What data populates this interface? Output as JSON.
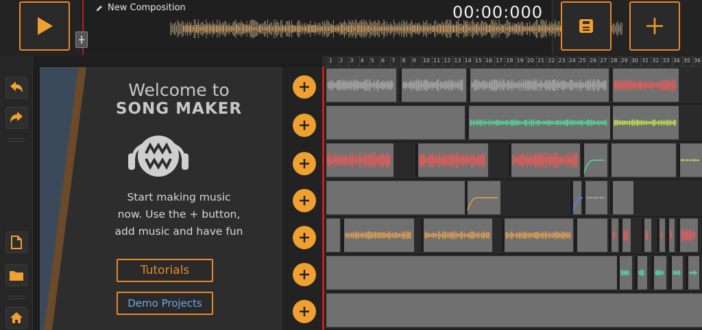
{
  "composition": {
    "title": "New Composition",
    "time": "00:00:000"
  },
  "welcome": {
    "line1": "Welcome to",
    "line2": "SONG MAKER",
    "body": [
      "Start making music",
      "now. Use the + button,",
      "add music and have fun"
    ],
    "tutorials_label": "Tutorials",
    "demo_label": "Demo Projects"
  },
  "ruler_ticks": [
    "1",
    "2",
    "3",
    "4",
    "5",
    "6",
    "7",
    "8",
    "9",
    "10",
    "11",
    "12",
    "13",
    "14",
    "15",
    "16",
    "17",
    "18",
    "19",
    "20",
    "21",
    "22",
    "23",
    "24",
    "25",
    "26",
    "27",
    "28",
    "29",
    "30",
    "31",
    "32",
    "33",
    "34",
    "35",
    "36"
  ],
  "colors": {
    "accent": "#e8892a",
    "add_circle": "#f0a030",
    "playhead": "#c82020",
    "link_blue": "#6fa8e8",
    "wave_grey": "#a9a9a9",
    "wave_red": "#e85a5a",
    "wave_green": "#4fe0a0",
    "wave_yellow": "#c9e84a",
    "wave_orange": "#e8a050",
    "wave_blue": "#4a8ae8"
  },
  "icons": {
    "play": "play-icon",
    "save": "save-icon",
    "add": "plus-icon",
    "undo": "undo-icon",
    "redo": "redo-icon",
    "new_file": "new-file-icon",
    "open_folder": "folder-icon",
    "home": "home-icon",
    "edit": "pencil-icon"
  }
}
